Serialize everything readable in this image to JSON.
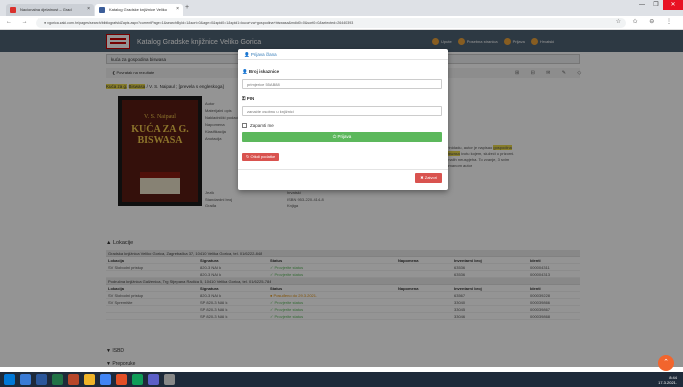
{
  "browser": {
    "tabs": [
      {
        "title": "Nacionalna djelatnost – Grad",
        "fav_color": "#d9302c"
      },
      {
        "title": "Katalog Gradske knjižnice Veliko",
        "fav_color": "#3b5d99"
      }
    ],
    "url": "● vgorica.zaki.com.hr/pages/search/bibliografskiZapis.aspx?currentPage=1&searchById=1&sort=0&age=0&spid0=1&spid1=kuca+za+gospodina+biswasa&mdid0=0&sort0=0&selected=26440393",
    "new_tab": "+",
    "nav_icons": "← → C ⌂",
    "right_icons": "☆ ✩ ⊖ ⋮",
    "window_controls": [
      "—",
      "❐",
      "✕"
    ]
  },
  "header": {
    "title": "Katalog Gradske knjižnice Veliko Gorica",
    "menu": [
      "Upute",
      "Posebna stranica",
      "Prijava",
      "Hrvatski"
    ]
  },
  "search": {
    "value": "kuća za gospodina biswasa"
  },
  "back": {
    "label": "❮ Povratak na rezultate"
  },
  "tools": "⊞ ⊟ ✉ ✎ ◇",
  "record": {
    "title_hl1": "Kuća za g.",
    "title_hl2": "Biswasa",
    "title_rest": "/ V. S. Naipaul ; [prevela s engleskoga]",
    "cover_author": "V. S. Naipaul",
    "cover_title": "KUĆA ZA G. BISWASA",
    "meta_labels": [
      "Autor",
      "Materijalni opis",
      "Nakladnički podaci",
      "Napomena",
      "Klasifikacija",
      "Anotacija"
    ],
    "meta2_labels": [
      "Jezik",
      "Standardni broj",
      "Građa"
    ],
    "meta2_values": [
      "hrvatski",
      "ISBN 953-220-414-8",
      "Knjiga"
    ],
    "desc_pre": "Trinidadu, autor je napisao",
    "desc_hl": "gospodina Biswasa",
    "desc_post": "ivotu kojem, služeći u prizorni. dmalih neuspjeha. To zvanje, 3 svim romanom autor"
  },
  "modal": {
    "title": "Prijava člana",
    "card_label": "Broj iskaznice",
    "card_placeholder": "primjerice 55AB88",
    "pin_label": "PIN",
    "pin_placeholder": "zanaćte osobnu u knjižnici",
    "remember_label": "Zapamti me",
    "login_label": "Prijava",
    "forgot_label": "Otkdi podatke",
    "close_label": "Zatvori"
  },
  "locations": {
    "title": "Lokacije",
    "headers": [
      "Lokacija",
      "Signatura",
      "Status",
      "Napomena",
      "Inventarni broj",
      "Identi"
    ],
    "branch1": "Gradska knjižnica Veliko Gorica, Zagrebačka 37, 10410 Velika Gorica, tel. 01/6222-848",
    "rows1": [
      [
        "SV Slobodni pristup",
        "820-3 NAI k",
        "✓ Provjerite status",
        "",
        "63536",
        "000004311"
      ],
      [
        "",
        "820-3 NAI k",
        "✓ Provjerite status",
        "",
        "63536",
        "000004313"
      ]
    ],
    "branch2": "Područna knjižnica Galženica, Trg Stjepana Radića 5, 10410 Velika Gorica, tel. 01/6225-784",
    "rows2": [
      [
        "SV Slobodni pristup",
        "820-3 NAI k",
        "● Posuđeno do 29.3.2021.",
        "",
        "63567",
        "000039228"
      ],
      [
        "SV Spremište",
        "SP 820-3 NAI k",
        "✓ Provjerite status",
        "",
        "33040",
        "000039866"
      ],
      [
        "",
        "SP 820-3 NAI k",
        "✓ Provjerite status",
        "",
        "33045",
        "000039867"
      ],
      [
        "",
        "SP 820-3 NAI k",
        "✓ Provjerite status",
        "",
        "33046",
        "000039868"
      ]
    ]
  },
  "sections": {
    "isbd": "ISBD",
    "prep": "Preporuke"
  },
  "taskbar": {
    "icons": [
      "#0078d7",
      "#3a7bd5",
      "#2b579a",
      "#217346",
      "#b7472a",
      "#f0b429",
      "#4285f4",
      "#e34f26",
      "#0f9d58",
      "#5b5fc7",
      "#888"
    ],
    "time": "8:44",
    "date": "17.3.2021."
  },
  "colors": {
    "header": "#4f6374",
    "login": "#5cb85c",
    "danger": "#d9534f",
    "fab": "#f2652d"
  }
}
